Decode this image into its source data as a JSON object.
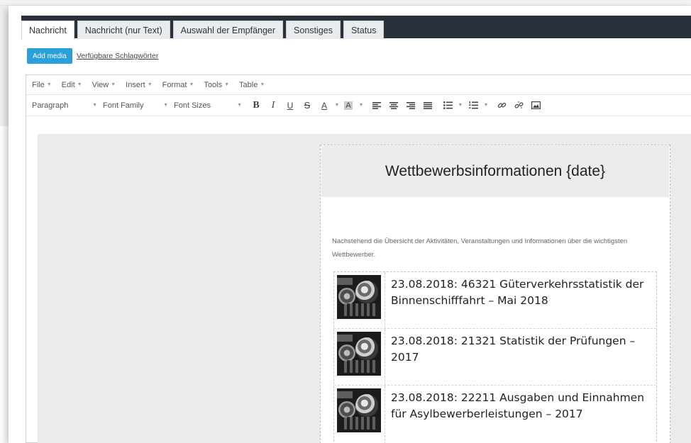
{
  "tabs": [
    {
      "label": "Nachricht",
      "active": true
    },
    {
      "label": "Nachricht (nur Text)",
      "active": false
    },
    {
      "label": "Auswahl der Empfänger",
      "active": false
    },
    {
      "label": "Sonstiges",
      "active": false
    },
    {
      "label": "Status",
      "active": false
    }
  ],
  "media": {
    "add_media_label": "Add media",
    "tags_link_label": "Verfügbare Schlagwörter"
  },
  "menubar": [
    "File",
    "Edit",
    "View",
    "Insert",
    "Format",
    "Tools",
    "Table"
  ],
  "toolbar": {
    "paragraph": "Paragraph",
    "font_family": "Font Family",
    "font_sizes": "Font Sizes"
  },
  "newsletter": {
    "title": "Wettbewerbsinformationen {date}",
    "intro": "Nachstehend die Übersicht der Aktivitäten, Veranstaltungen und Informationen über die wichtigsten Wettbewerber.",
    "items": [
      {
        "text": "23.08.2018: 46321 Güterverkehrsstatistik der Binnenschifffahrt – Mai 2018"
      },
      {
        "text": "23.08.2018: 21321 Statistik der Prüfungen – 2017"
      },
      {
        "text": "23.08.2018: 22211 Ausgaben und Einnahmen für Asylbewerberleistungen – 2017"
      }
    ]
  },
  "colors": {
    "header_bar": "#2a313b",
    "add_media_button": "#2a9fd8",
    "editor_background": "#ebebeb"
  }
}
